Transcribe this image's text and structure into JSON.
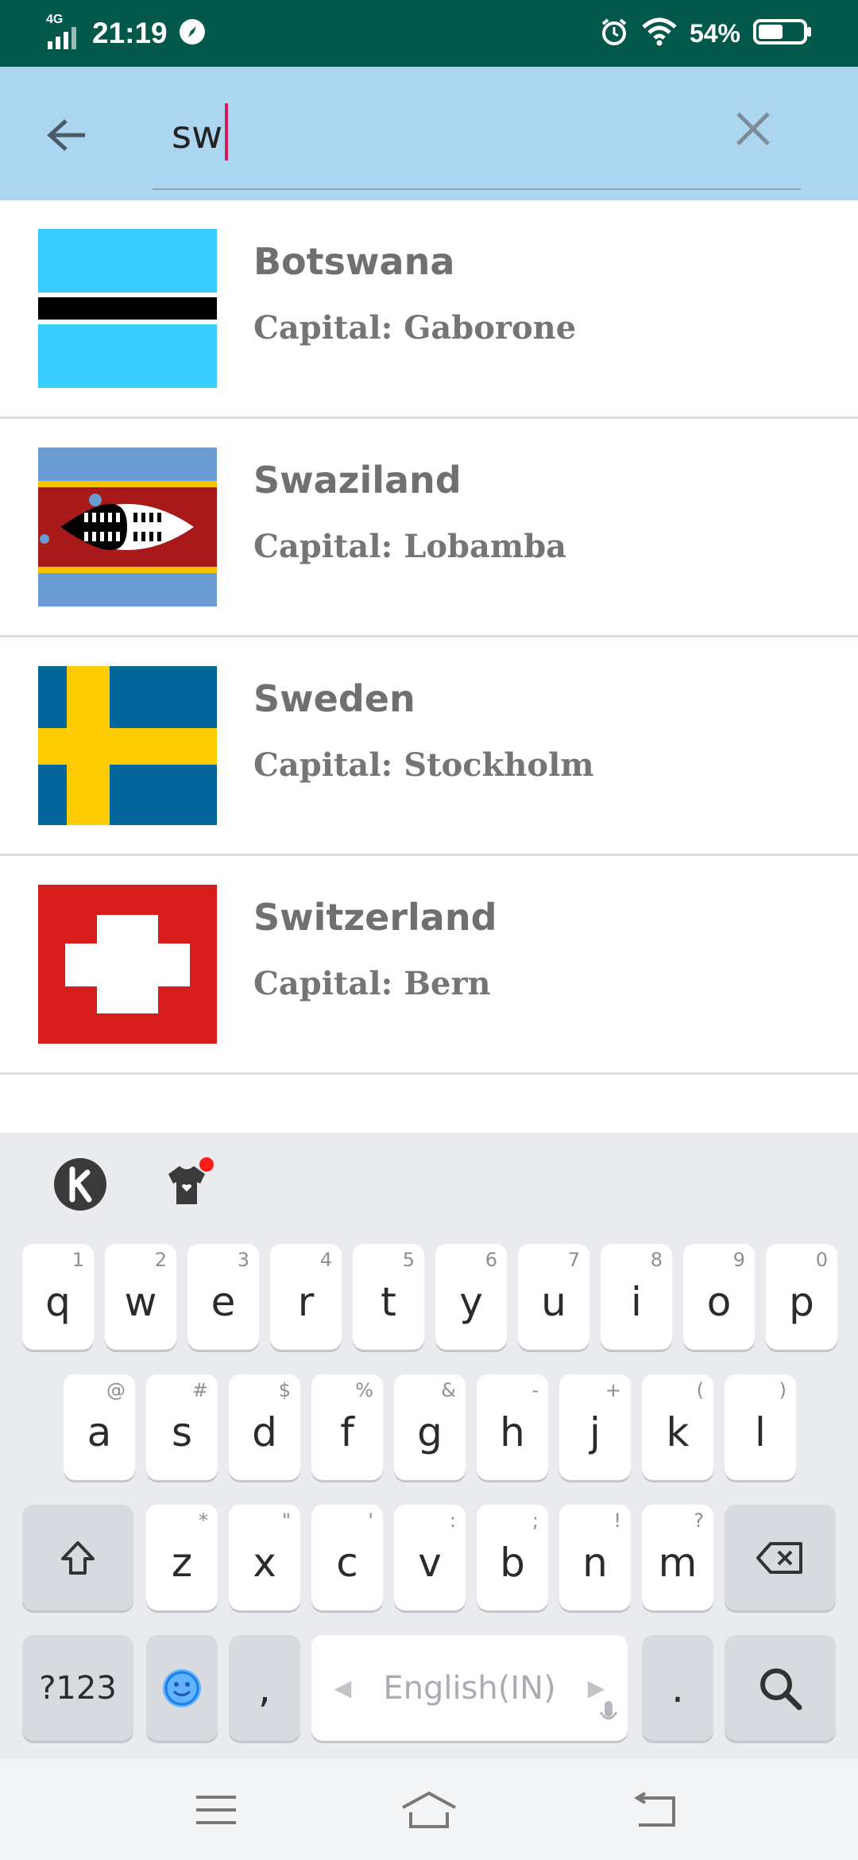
{
  "status_bar": {
    "network": "4G",
    "time": "21:19",
    "battery": "54%",
    "icons": [
      "signal-icon",
      "compass-icon",
      "alarm-icon",
      "wifi-icon",
      "battery-icon"
    ]
  },
  "search": {
    "value": "sw",
    "back_icon": "arrow-left-icon",
    "clear_icon": "close-icon"
  },
  "results": [
    {
      "country": "Botswana",
      "capital": "Capital: Gaborone",
      "flag": "botswana-flag"
    },
    {
      "country": "Swaziland",
      "capital": "Capital: Lobamba",
      "flag": "swaziland-flag"
    },
    {
      "country": "Sweden",
      "capital": "Capital: Stockholm",
      "flag": "sweden-flag"
    },
    {
      "country": "Switzerland",
      "capital": "Capital: Bern",
      "flag": "switzerland-flag"
    }
  ],
  "keyboard": {
    "toolbar": [
      "k-logo-icon",
      "tshirt-icon"
    ],
    "row1": [
      [
        "q",
        "1"
      ],
      [
        "w",
        "2"
      ],
      [
        "e",
        "3"
      ],
      [
        "r",
        "4"
      ],
      [
        "t",
        "5"
      ],
      [
        "y",
        "6"
      ],
      [
        "u",
        "7"
      ],
      [
        "i",
        "8"
      ],
      [
        "o",
        "9"
      ],
      [
        "p",
        "0"
      ]
    ],
    "row2": [
      [
        "a",
        "@"
      ],
      [
        "s",
        "#"
      ],
      [
        "d",
        "$"
      ],
      [
        "f",
        "%"
      ],
      [
        "g",
        "&"
      ],
      [
        "h",
        "-"
      ],
      [
        "j",
        "+"
      ],
      [
        "k",
        "("
      ],
      [
        "l",
        ")"
      ]
    ],
    "row3": [
      [
        "z",
        "*"
      ],
      [
        "x",
        "\""
      ],
      [
        "c",
        "'"
      ],
      [
        "v",
        ":"
      ],
      [
        "b",
        ";"
      ],
      [
        "n",
        "!"
      ],
      [
        "m",
        "?"
      ]
    ],
    "symbols_label": "?123",
    "comma": ",",
    "space_label": "English(IN)",
    "period": "."
  },
  "nav_bar": [
    "menu-icon",
    "home-icon",
    "back-icon"
  ]
}
